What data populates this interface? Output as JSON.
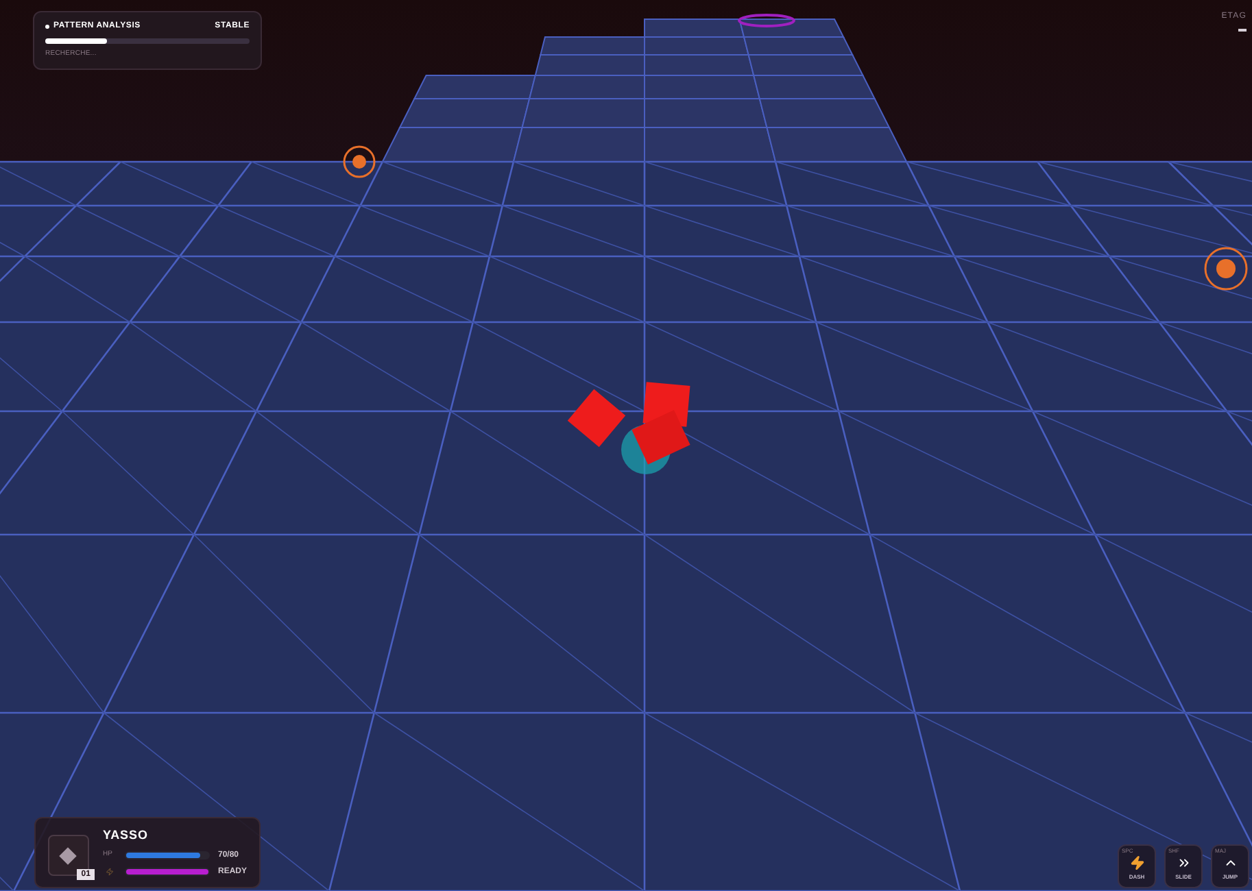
{
  "analysis": {
    "title": "PATTERN ANALYSIS",
    "status": "STABLE",
    "level": 0.3,
    "caption": "RECHERCHE..."
  },
  "floor_label": {
    "text": "ETAG"
  },
  "player": {
    "name": "YASSO",
    "badge": "01",
    "hp_label": "HP",
    "hp": {
      "level": 0.9,
      "reading": "70/80"
    },
    "energy": {
      "level": 1,
      "reading": "READY"
    }
  },
  "abilities": [
    {
      "key": "SPC",
      "kind": "zap",
      "label": "DASH"
    },
    {
      "key": "SHF",
      "kind": "chevrons",
      "label": "SLIDE"
    },
    {
      "key": "MAJ",
      "kind": "chevron",
      "label": "JUMP"
    }
  ]
}
